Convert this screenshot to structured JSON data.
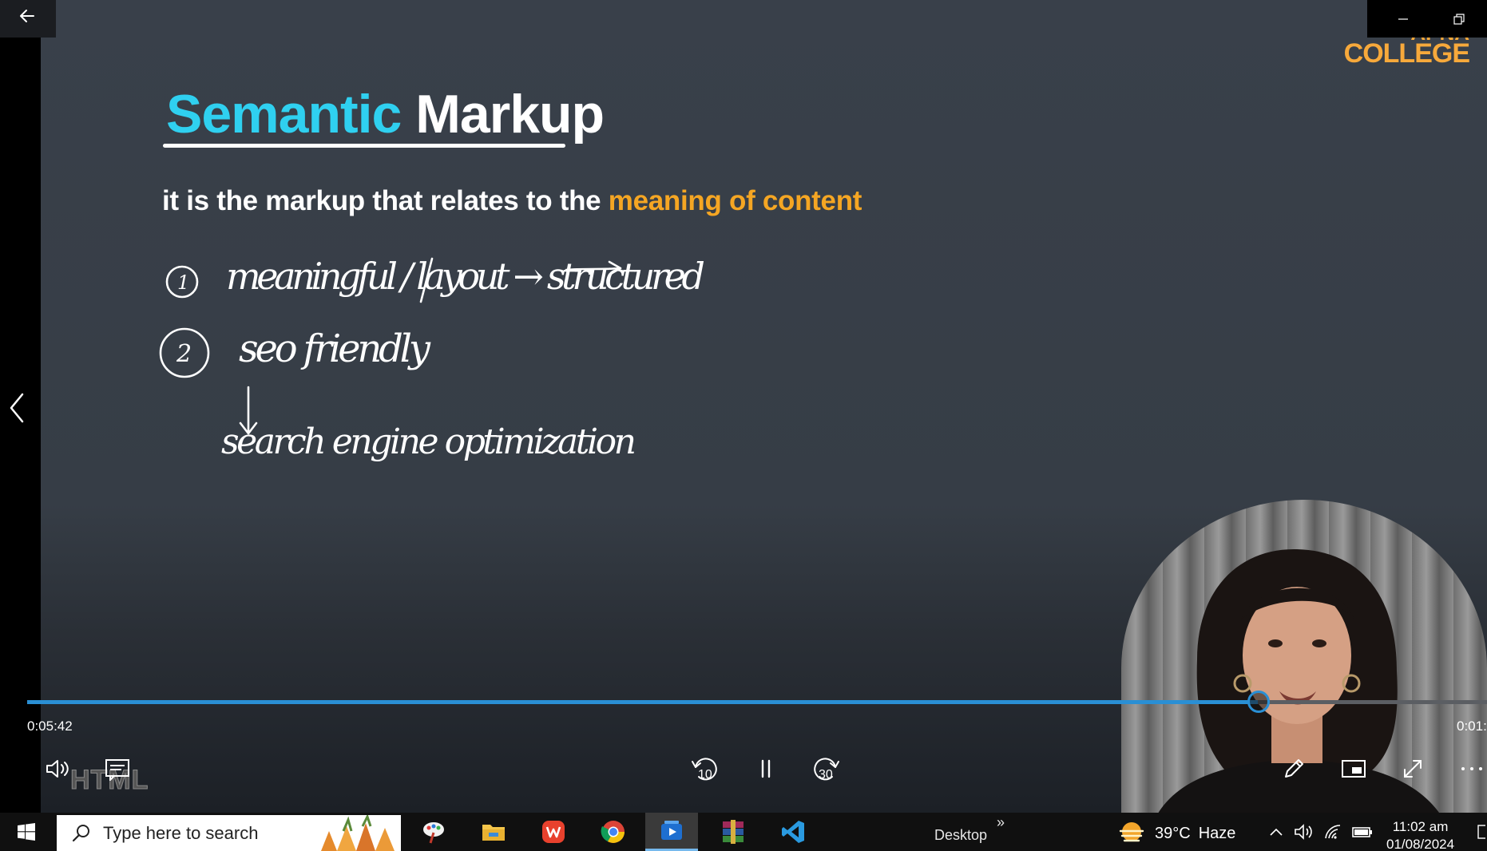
{
  "window": {
    "back_label": "Back",
    "minimize_label": "Minimize",
    "restore_label": "Restore"
  },
  "logo": {
    "top": "APNA",
    "bottom": "COLLEGE",
    "color": "#f7a93b"
  },
  "slide": {
    "title_part1": "Semantic",
    "title_part2": "Markup",
    "subtitle_main": "it is the markup that relates to the ",
    "subtitle_accent": "meaning of content",
    "title_accent_color": "#2fd0f0",
    "subtitle_accent_color": "#f5a623",
    "handwriting": {
      "item1_num": "1",
      "item1": "meaningful / layout → structured",
      "item2_num": "2",
      "item2": "seo friendly",
      "item2_expansion": "search engine optimization"
    }
  },
  "player": {
    "progress": 0.843,
    "current_time": "0:05:42",
    "total_time": "0:01:",
    "rewind_seconds": "10",
    "forward_seconds": "30",
    "watermark": "HTML",
    "accent_color": "#2a8fd4",
    "icons": [
      "volume-icon",
      "captions-icon",
      "rewind-icon",
      "pause-icon",
      "forward-icon",
      "pencil-icon",
      "miniplayer-icon",
      "fullscreen-icon",
      "more-icon"
    ]
  },
  "taskbar": {
    "search_placeholder": "Type here to search",
    "desktop_label": "Desktop",
    "chevron": "»",
    "weather_temp": "39°C",
    "weather_desc": "Haze",
    "time": "11:02 am",
    "date": "01/08/2024",
    "apps": [
      "paint-app-icon",
      "file-explorer-icon",
      "wps-office-icon",
      "chrome-icon",
      "media-player-icon",
      "winrar-icon",
      "vscode-icon"
    ]
  }
}
